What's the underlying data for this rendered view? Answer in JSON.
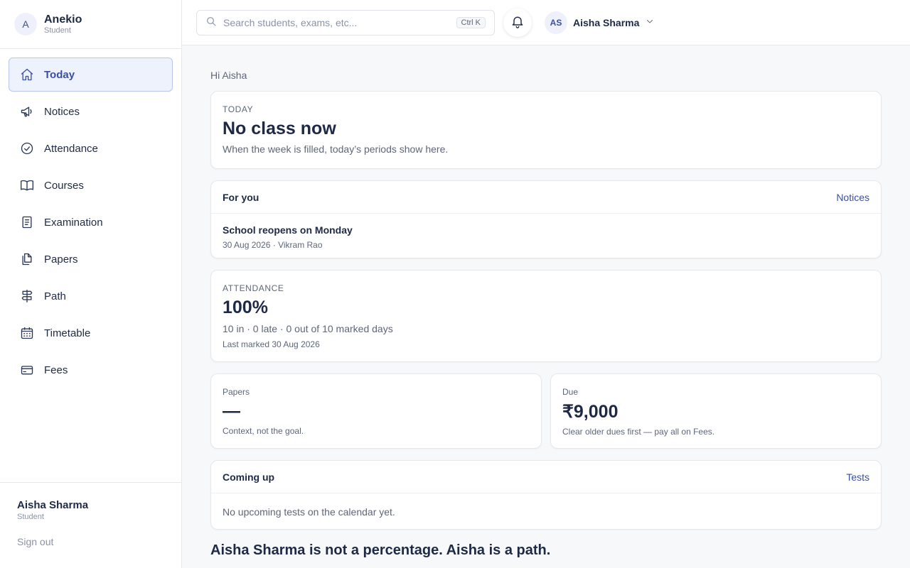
{
  "brand": {
    "initial": "A",
    "name": "Anekio",
    "role": "Student"
  },
  "sidebar": {
    "items": [
      {
        "label": "Today",
        "icon": "home-icon",
        "active": true
      },
      {
        "label": "Notices",
        "icon": "megaphone-icon"
      },
      {
        "label": "Attendance",
        "icon": "check-circle-icon"
      },
      {
        "label": "Courses",
        "icon": "book-icon"
      },
      {
        "label": "Examination",
        "icon": "document-icon"
      },
      {
        "label": "Papers",
        "icon": "papers-icon"
      },
      {
        "label": "Path",
        "icon": "signpost-icon"
      },
      {
        "label": "Timetable",
        "icon": "calendar-icon"
      },
      {
        "label": "Fees",
        "icon": "card-icon"
      }
    ],
    "footer": {
      "name": "Aisha Sharma",
      "role": "Student",
      "sign_out": "Sign out"
    }
  },
  "topbar": {
    "search_placeholder": "Search students, exams, etc...",
    "shortcut": "Ctrl K",
    "user_initials": "AS",
    "user_name": "Aisha Sharma"
  },
  "main": {
    "greeting": "Hi Aisha",
    "today": {
      "eyebrow": "TODAY",
      "title": "No class now",
      "subtitle": "When the week is filled, today’s periods show here."
    },
    "for_you": {
      "title": "For you",
      "link": "Notices",
      "notice_title": "School reopens on Monday",
      "notice_meta": "30 Aug 2026 · Vikram Rao"
    },
    "attendance": {
      "eyebrow": "ATTENDANCE",
      "value": "100%",
      "summary": "10 in · 0 late · 0 out of 10 marked days",
      "last_marked": "Last marked 30 Aug 2026"
    },
    "papers": {
      "label": "Papers",
      "value": "—",
      "note": "Context, not the goal."
    },
    "due": {
      "label": "Due",
      "value": "₹9,000",
      "note": "Clear older dues first — pay all on Fees."
    },
    "coming_up": {
      "title": "Coming up",
      "link": "Tests",
      "empty": "No upcoming tests on the calendar yet."
    },
    "motto": "Aisha Sharma is not a percentage. Aisha is a path."
  },
  "colors": {
    "accent": "#3b4fa0",
    "text": "#1e2a45",
    "muted": "#5d6678",
    "border": "#e5e7eb"
  }
}
